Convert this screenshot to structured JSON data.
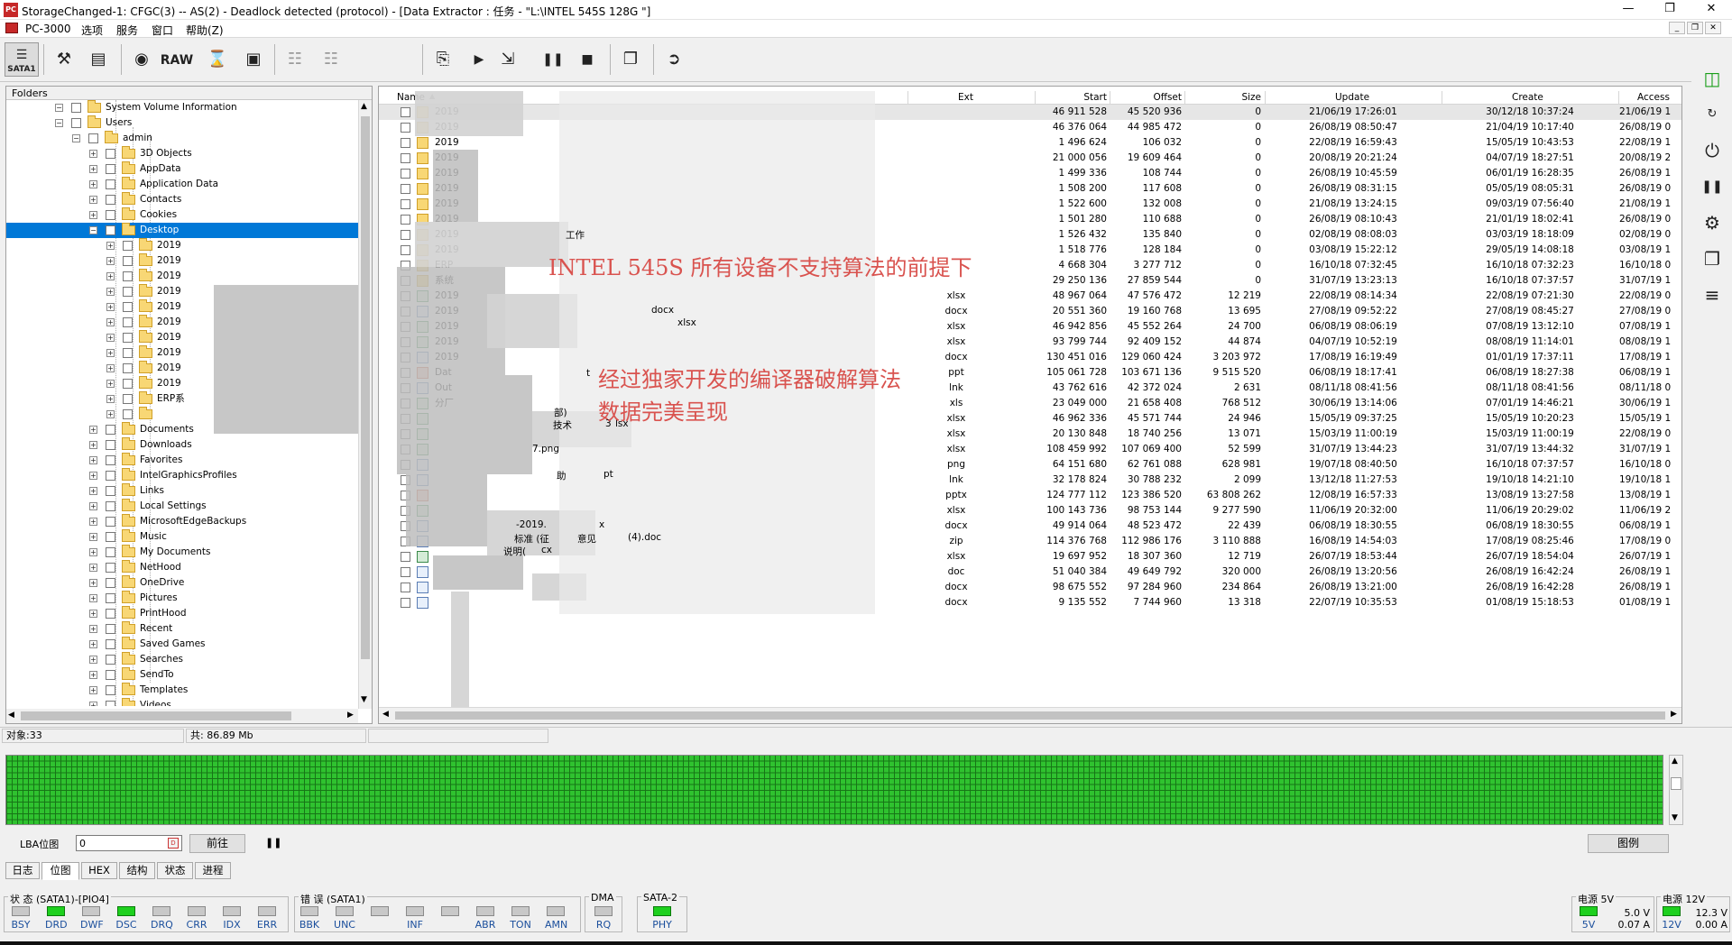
{
  "window": {
    "title": "StorageChanged-1: CFGC(3) -- AS(2) - Deadlock detected (protocol) - [Data Extractor : 任务 - \"L:\\INTEL 545S  128G   \"]",
    "app_icon_text": "PC"
  },
  "menu": {
    "items": [
      "PC-3000",
      "选项",
      "服务",
      "窗口",
      "帮助(Z)"
    ]
  },
  "toolbar": {
    "sata_label": "SATA1",
    "raw_label": "RAW"
  },
  "folders": {
    "header": "Folders",
    "rows": [
      {
        "label": "System Volume Information"
      },
      {
        "label": "Users"
      },
      {
        "label": "admin"
      },
      {
        "label": "3D Objects"
      },
      {
        "label": "AppData"
      },
      {
        "label": "Application Data"
      },
      {
        "label": "Contacts"
      },
      {
        "label": "Cookies"
      },
      {
        "label": "Desktop",
        "selected": true
      },
      {
        "label": "2019"
      },
      {
        "label": "2019"
      },
      {
        "label": "2019"
      },
      {
        "label": "2019"
      },
      {
        "label": "2019"
      },
      {
        "label": "2019"
      },
      {
        "label": "2019"
      },
      {
        "label": "2019"
      },
      {
        "label": "2019"
      },
      {
        "label": "2019"
      },
      {
        "label": "ERP系"
      },
      {
        "label": ""
      },
      {
        "label": "Documents"
      },
      {
        "label": "Downloads"
      },
      {
        "label": "Favorites"
      },
      {
        "label": "IntelGraphicsProfiles"
      },
      {
        "label": "Links"
      },
      {
        "label": "Local Settings"
      },
      {
        "label": "MicrosoftEdgeBackups"
      },
      {
        "label": "Music"
      },
      {
        "label": "My Documents"
      },
      {
        "label": "NetHood"
      },
      {
        "label": "OneDrive"
      },
      {
        "label": "Pictures"
      },
      {
        "label": "PrintHood"
      },
      {
        "label": "Recent"
      },
      {
        "label": "Saved Games"
      },
      {
        "label": "Searches"
      },
      {
        "label": "SendTo"
      },
      {
        "label": "Templates"
      },
      {
        "label": "Videos"
      }
    ]
  },
  "filelist": {
    "columns": [
      "Name",
      "Ext",
      "Start",
      "Offset",
      "Size",
      "Update",
      "Create",
      "Access"
    ],
    "rows": [
      {
        "name": "2019",
        "ext": "",
        "start": "46 911 528",
        "offset": "45 520 936",
        "size": "0",
        "update": "21/06/19 17:26:01",
        "create": "30/12/18 10:37:24",
        "access": "21/06/19 1",
        "icon": "folder"
      },
      {
        "name": "2019",
        "ext": "",
        "start": "46 376 064",
        "offset": "44 985 472",
        "size": "0",
        "update": "26/08/19 08:50:47",
        "create": "21/04/19 10:17:40",
        "access": "26/08/19 0",
        "icon": "folder"
      },
      {
        "name": "2019",
        "ext": "",
        "start": "1 496 624",
        "offset": "106 032",
        "size": "0",
        "update": "22/08/19 16:59:43",
        "create": "15/05/19 10:43:53",
        "access": "22/08/19 1",
        "icon": "folder"
      },
      {
        "name": "2019",
        "ext": "",
        "start": "21 000 056",
        "offset": "19 609 464",
        "size": "0",
        "update": "20/08/19 20:21:24",
        "create": "04/07/19 18:27:51",
        "access": "20/08/19 2",
        "icon": "folder"
      },
      {
        "name": "2019",
        "ext": "",
        "start": "1 499 336",
        "offset": "108 744",
        "size": "0",
        "update": "26/08/19 10:45:59",
        "create": "06/01/19 16:28:35",
        "access": "26/08/19 1",
        "icon": "folder"
      },
      {
        "name": "2019",
        "ext": "",
        "start": "1 508 200",
        "offset": "117 608",
        "size": "0",
        "update": "26/08/19 08:31:15",
        "create": "05/05/19 08:05:31",
        "access": "26/08/19 0",
        "icon": "folder"
      },
      {
        "name": "2019",
        "ext": "",
        "start": "1 522 600",
        "offset": "132 008",
        "size": "0",
        "update": "21/08/19 13:24:15",
        "create": "09/03/19 07:56:40",
        "access": "21/08/19 1",
        "icon": "folder"
      },
      {
        "name": "2019",
        "ext": "",
        "start": "1 501 280",
        "offset": "110 688",
        "size": "0",
        "update": "26/08/19 08:10:43",
        "create": "21/01/19 18:02:41",
        "access": "26/08/19 0",
        "icon": "folder"
      },
      {
        "name": "2019",
        "ext": "",
        "start": "1 526 432",
        "offset": "135 840",
        "size": "0",
        "update": "02/08/19 08:08:03",
        "create": "03/03/19 18:18:09",
        "access": "02/08/19 0",
        "icon": "folder"
      },
      {
        "name": "2019",
        "ext": "",
        "start": "1 518 776",
        "offset": "128 184",
        "size": "0",
        "update": "03/08/19 15:22:12",
        "create": "29/05/19 14:08:18",
        "access": "03/08/19 1",
        "icon": "folder"
      },
      {
        "name": "ERP",
        "ext": "",
        "start": "4 668 304",
        "offset": "3 277 712",
        "size": "0",
        "update": "16/10/18 07:32:45",
        "create": "16/10/18 07:32:23",
        "access": "16/10/18 0",
        "icon": "folder"
      },
      {
        "name": "系统",
        "ext": "",
        "start": "29 250 136",
        "offset": "27 859 544",
        "size": "0",
        "update": "31/07/19 13:23:13",
        "create": "16/10/18 07:37:57",
        "access": "31/07/19 1",
        "icon": "folder"
      },
      {
        "name": "2019",
        "ext": "xlsx",
        "start": "48 967 064",
        "offset": "47 576 472",
        "size": "12 219",
        "update": "22/08/19 08:14:34",
        "create": "22/08/19 07:21:30",
        "access": "22/08/19 0",
        "icon": "xls"
      },
      {
        "name": "2019",
        "ext": "docx",
        "start": "20 551 360",
        "offset": "19 160 768",
        "size": "13 695",
        "update": "27/08/19 09:52:22",
        "create": "27/08/19 08:45:27",
        "access": "27/08/19 0",
        "icon": "doc"
      },
      {
        "name": "2019",
        "ext": "xlsx",
        "start": "46 942 856",
        "offset": "45 552 264",
        "size": "24 700",
        "update": "06/08/19 08:06:19",
        "create": "07/08/19 13:12:10",
        "access": "07/08/19 1",
        "icon": "xls"
      },
      {
        "name": "2019",
        "ext": "xlsx",
        "start": "93 799 744",
        "offset": "92 409 152",
        "size": "44 874",
        "update": "04/07/19 10:52:19",
        "create": "08/08/19 11:14:01",
        "access": "08/08/19 1",
        "icon": "xls"
      },
      {
        "name": "2019",
        "ext": "docx",
        "start": "130 451 016",
        "offset": "129 060 424",
        "size": "3 203 972",
        "update": "17/08/19 16:19:49",
        "create": "01/01/19 17:37:11",
        "access": "17/08/19 1",
        "icon": "doc"
      },
      {
        "name": "Dat",
        "ext": "ppt",
        "start": "105 061 728",
        "offset": "103 671 136",
        "size": "9 515 520",
        "update": "06/08/19 18:17:41",
        "create": "06/08/19 18:27:38",
        "access": "06/08/19 1",
        "icon": "ppt"
      },
      {
        "name": "Out",
        "ext": "lnk",
        "start": "43 762 616",
        "offset": "42 372 024",
        "size": "2 631",
        "update": "08/11/18 08:41:56",
        "create": "08/11/18 08:41:56",
        "access": "08/11/18 0",
        "icon": "doc"
      },
      {
        "name": "分厂",
        "ext": "xls",
        "start": "23 049 000",
        "offset": "21 658 408",
        "size": "768 512",
        "update": "30/06/19 13:14:06",
        "create": "07/01/19 14:46:21",
        "access": "30/06/19 1",
        "icon": "xls"
      },
      {
        "name": "",
        "ext": "xlsx",
        "start": "46 962 336",
        "offset": "45 571 744",
        "size": "24 946",
        "update": "15/05/19 09:37:25",
        "create": "15/05/19 10:20:23",
        "access": "15/05/19 1",
        "icon": "xls"
      },
      {
        "name": "",
        "ext": "xlsx",
        "start": "20 130 848",
        "offset": "18 740 256",
        "size": "13 071",
        "update": "15/03/19 11:00:19",
        "create": "15/03/19 11:00:19",
        "access": "22/08/19 0",
        "icon": "xls"
      },
      {
        "name": "",
        "ext": "xlsx",
        "start": "108 459 992",
        "offset": "107 069 400",
        "size": "52 599",
        "update": "31/07/19 13:44:23",
        "create": "31/07/19 13:44:32",
        "access": "31/07/19 1",
        "icon": "xls"
      },
      {
        "name": "",
        "ext": "png",
        "start": "64 151 680",
        "offset": "62 761 088",
        "size": "628 981",
        "update": "19/07/18 08:40:50",
        "create": "16/10/18 07:37:57",
        "access": "16/10/18 0",
        "icon": "doc"
      },
      {
        "name": "",
        "ext": "lnk",
        "start": "32 178 824",
        "offset": "30 788 232",
        "size": "2 099",
        "update": "13/12/18 11:27:53",
        "create": "19/10/18 14:21:10",
        "access": "19/10/18 1",
        "icon": "doc"
      },
      {
        "name": "",
        "ext": "pptx",
        "start": "124 777 112",
        "offset": "123 386 520",
        "size": "63 808 262",
        "update": "12/08/19 16:57:33",
        "create": "13/08/19 13:27:58",
        "access": "13/08/19 1",
        "icon": "ppt"
      },
      {
        "name": "",
        "ext": "xlsx",
        "start": "100 143 736",
        "offset": "98 753 144",
        "size": "9 277 590",
        "update": "11/06/19 20:32:00",
        "create": "11/06/19 20:29:02",
        "access": "11/06/19 2",
        "icon": "xls"
      },
      {
        "name": "",
        "ext": "docx",
        "start": "49 914 064",
        "offset": "48 523 472",
        "size": "22 439",
        "update": "06/08/19 18:30:55",
        "create": "06/08/19 18:30:55",
        "access": "06/08/19 1",
        "icon": "doc"
      },
      {
        "name": "",
        "ext": "zip",
        "start": "114 376 768",
        "offset": "112 986 176",
        "size": "3 110 888",
        "update": "16/08/19 14:54:03",
        "create": "17/08/19 08:25:46",
        "access": "17/08/19 0",
        "icon": "doc"
      },
      {
        "name": "",
        "ext": "xlsx",
        "start": "19 697 952",
        "offset": "18 307 360",
        "size": "12 719",
        "update": "26/07/19 18:53:44",
        "create": "26/07/19 18:54:04",
        "access": "26/07/19 1",
        "icon": "xls"
      },
      {
        "name": "",
        "ext": "doc",
        "start": "51 040 384",
        "offset": "49 649 792",
        "size": "320 000",
        "update": "26/08/19 13:20:56",
        "create": "26/08/19 16:42:24",
        "access": "26/08/19 1",
        "icon": "doc"
      },
      {
        "name": "",
        "ext": "docx",
        "start": "98 675 552",
        "offset": "97 284 960",
        "size": "234 864",
        "update": "26/08/19 13:21:00",
        "create": "26/08/19 16:42:28",
        "access": "26/08/19 1",
        "icon": "doc"
      },
      {
        "name": "",
        "ext": "docx",
        "start": "9 135 552",
        "offset": "7 744 960",
        "size": "13 318",
        "update": "22/07/19 10:35:53",
        "create": "01/08/19 15:18:53",
        "access": "01/08/19 1",
        "icon": "doc"
      }
    ],
    "name_fragments": [
      "工作",
      "docx",
      "xlsx",
      "t",
      "部)",
      "技术",
      "3",
      "lsx",
      "7.png",
      "助",
      "pt",
      "-2019.",
      "x",
      "标准 (征",
      "意见",
      "(4).doc",
      "说明(",
      "cx"
    ]
  },
  "overlay": {
    "line1": "INTEL 545S 所有设备不支持算法的前提下",
    "line2": "经过独家开发的编译器破解算法",
    "line3": "数据完美呈现"
  },
  "status": {
    "objects": "对象:33",
    "total": "共: 86.89 Mb"
  },
  "lba": {
    "label": "LBA位图",
    "value": "0",
    "go_button": "前往",
    "legend_button": "图例"
  },
  "tabs": [
    "日志",
    "位图",
    "HEX",
    "结构",
    "状态",
    "进程"
  ],
  "active_tab": "位图",
  "leds": {
    "status_group": "状 态 (SATA1)-[PIO4]",
    "status": [
      {
        "name": "BSY",
        "on": false
      },
      {
        "name": "DRD",
        "on": true
      },
      {
        "name": "DWF",
        "on": false
      },
      {
        "name": "DSC",
        "on": true
      },
      {
        "name": "DRQ",
        "on": false
      },
      {
        "name": "CRR",
        "on": false
      },
      {
        "name": "IDX",
        "on": false
      },
      {
        "name": "ERR",
        "on": false
      }
    ],
    "error_group": "错 误 (SATA1)",
    "errors": [
      {
        "name": "BBK",
        "on": false
      },
      {
        "name": "UNC",
        "on": false
      },
      {
        "name": "",
        "on": false
      },
      {
        "name": "INF",
        "on": false
      },
      {
        "name": "",
        "on": false
      },
      {
        "name": "ABR",
        "on": false
      },
      {
        "name": "TON",
        "on": false
      },
      {
        "name": "AMN",
        "on": false
      }
    ],
    "dma_group": "DMA",
    "dma": [
      {
        "name": "RQ",
        "on": false
      }
    ],
    "sata_group": "SATA-2",
    "sata": [
      {
        "name": "PHY",
        "on": true
      }
    ],
    "power5_group": "电源 5V",
    "power5": {
      "led": "5V",
      "voltage": "5.0 V",
      "current": "0.07 A"
    },
    "power12_group": "电源 12V",
    "power12": {
      "led": "12V",
      "voltage": "12.3 V",
      "current": "0.00 A"
    }
  },
  "colors": {
    "selection": "#0078d7",
    "led_on": "#1ed01e",
    "bitmap_green": "#2fc22f",
    "overlay_red": "#d9534f"
  }
}
